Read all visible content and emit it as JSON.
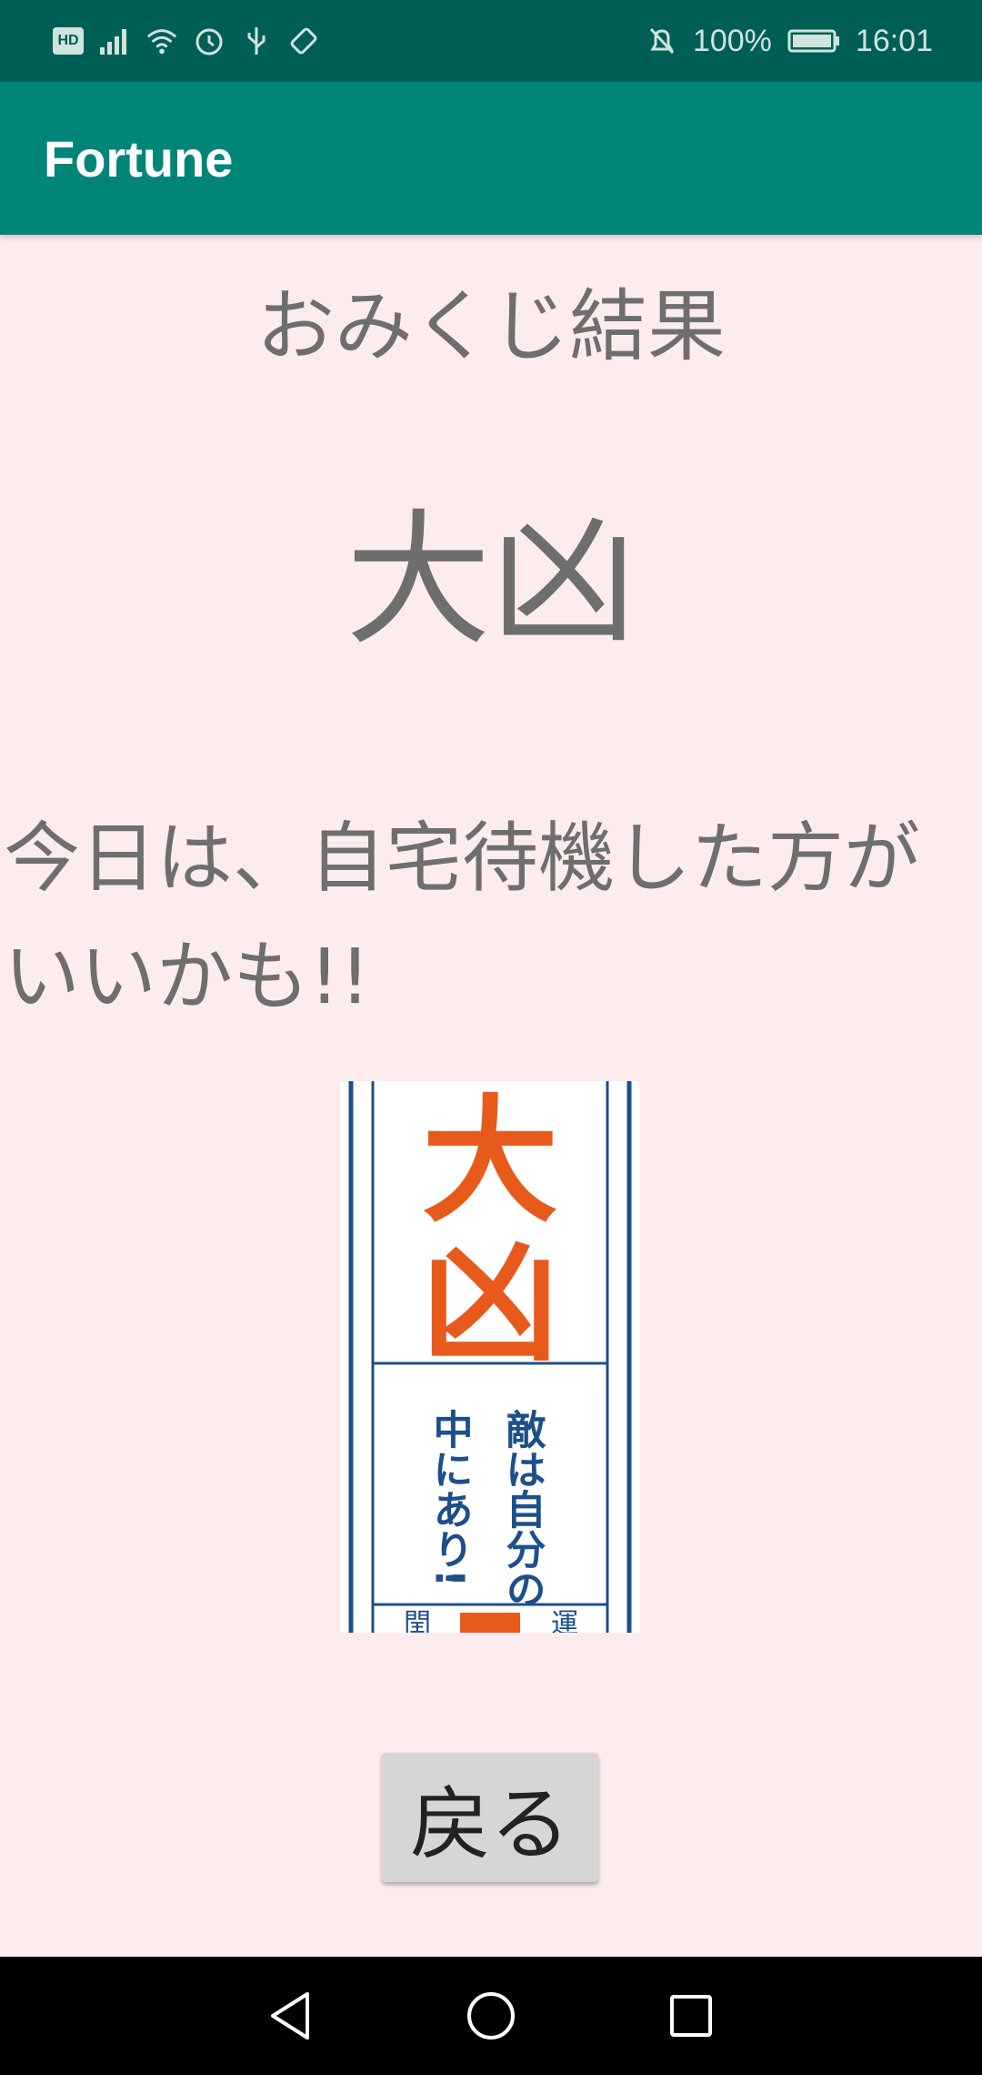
{
  "status_bar": {
    "battery": "100%",
    "time": "16:01",
    "hd_label": "HD",
    "icons": [
      "hd-icon",
      "signal-icon",
      "wifi-icon",
      "alarm-icon",
      "usb-icon",
      "rotate-icon",
      "mute-icon",
      "battery-icon"
    ]
  },
  "app_bar": {
    "title": "Fortune"
  },
  "main": {
    "heading": "おみくじ結果",
    "result": "大凶",
    "message": "今日は、自宅待機した方がいいかも!!",
    "image": {
      "big_text": "大凶",
      "fortune_text_right": "敵は自分の",
      "fortune_text_left": "中にあり!",
      "bottom_left": "閏",
      "bottom_right": "運"
    },
    "back_button": "戻る"
  },
  "colors": {
    "status_bar": "#005f54",
    "app_bar": "#008577",
    "background": "#fdeced",
    "text": "#6e6e6e",
    "omikuji_orange": "#e85a1c",
    "omikuji_blue": "#1d4f8a"
  },
  "nav_bar": {
    "icons": [
      "back-icon",
      "home-icon",
      "recents-icon"
    ]
  }
}
